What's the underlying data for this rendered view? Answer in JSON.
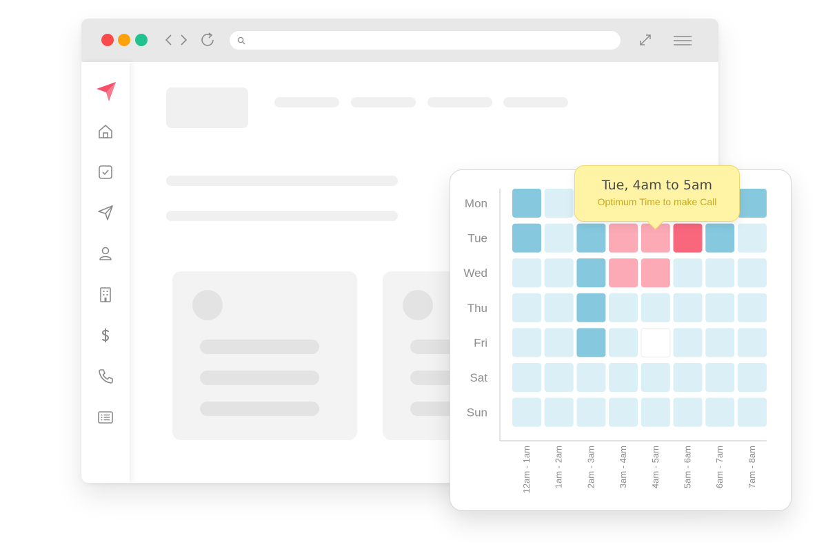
{
  "browser": {
    "window_controls": [
      {
        "name": "close",
        "color": "#fb4a4a"
      },
      {
        "name": "minimize",
        "color": "#fda20b"
      },
      {
        "name": "maximize",
        "color": "#21c28f"
      }
    ],
    "url": "",
    "icons": [
      "chevron-left-icon",
      "chevron-right-icon",
      "reload-icon",
      "search-icon",
      "expand-icon",
      "menu-icon"
    ]
  },
  "sidebar": {
    "logo_color": "#f9506a",
    "items": [
      "home-icon",
      "tasks-icon",
      "send-icon",
      "user-icon",
      "building-icon",
      "dollar-icon",
      "phone-icon",
      "list-icon"
    ]
  },
  "chart_data": {
    "type": "heatmap",
    "rows": [
      "Mon",
      "Tue",
      "Wed",
      "Thu",
      "Fri",
      "Sat",
      "Sun"
    ],
    "columns": [
      "12am - 1am",
      "1am - 2am",
      "2am - 3am",
      "3am - 4am",
      "4am - 5am",
      "5am - 6am",
      "6am - 7am",
      "7am - 8am"
    ],
    "levels_legend": {
      "0": "#ffffff",
      "1": "#daeff6",
      "2": "#86c9df",
      "3": "#fcaab6",
      "4": "#f9677d"
    },
    "values": [
      [
        2,
        1,
        1,
        1,
        1,
        1,
        1,
        2
      ],
      [
        2,
        1,
        2,
        3,
        3,
        4,
        2,
        1
      ],
      [
        1,
        1,
        2,
        3,
        3,
        1,
        1,
        1
      ],
      [
        1,
        1,
        2,
        1,
        1,
        1,
        1,
        1
      ],
      [
        1,
        1,
        2,
        1,
        0,
        1,
        1,
        1
      ],
      [
        1,
        1,
        1,
        1,
        1,
        1,
        1,
        1
      ],
      [
        1,
        1,
        1,
        1,
        1,
        1,
        1,
        1
      ]
    ],
    "grid": false
  },
  "tooltip": {
    "title": "Tue, 4am to 5am",
    "subtitle": "Optimum Time to make Call"
  }
}
